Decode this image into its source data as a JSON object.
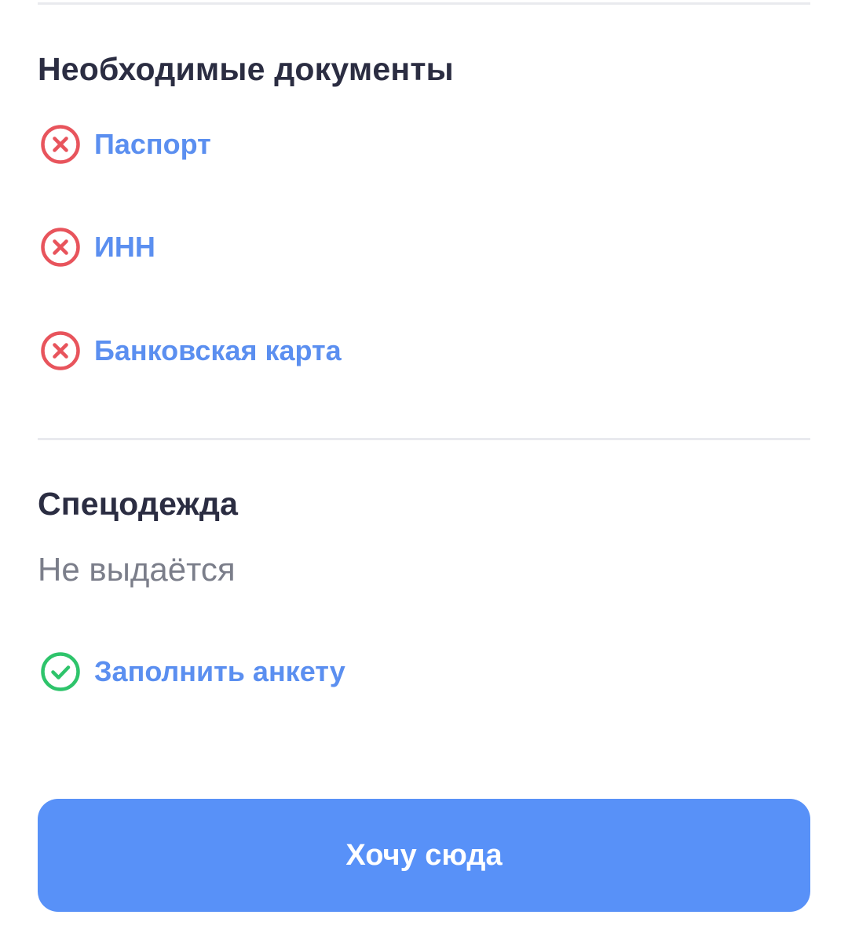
{
  "documents": {
    "title": "Необходимые документы",
    "items": [
      {
        "label": "Паспорт",
        "status": "missing",
        "icon": "close-circle-icon"
      },
      {
        "label": "ИНН",
        "status": "missing",
        "icon": "close-circle-icon"
      },
      {
        "label": "Банковская карта",
        "status": "missing",
        "icon": "close-circle-icon"
      }
    ]
  },
  "workwear": {
    "title": "Спецодежда",
    "value": "Не выдаётся"
  },
  "questionnaire": {
    "label": "Заполнить анкету",
    "status": "done",
    "icon": "check-circle-icon"
  },
  "cta": {
    "label": "Хочу сюда"
  },
  "colors": {
    "title_text": "#2b2d42",
    "link_text": "#5b8ff0",
    "missing_status": "#e8545c",
    "done_status": "#2ec46b",
    "button_background": "#5891f8",
    "divider": "#e9eaee",
    "secondary_text": "#7b7e8a"
  }
}
